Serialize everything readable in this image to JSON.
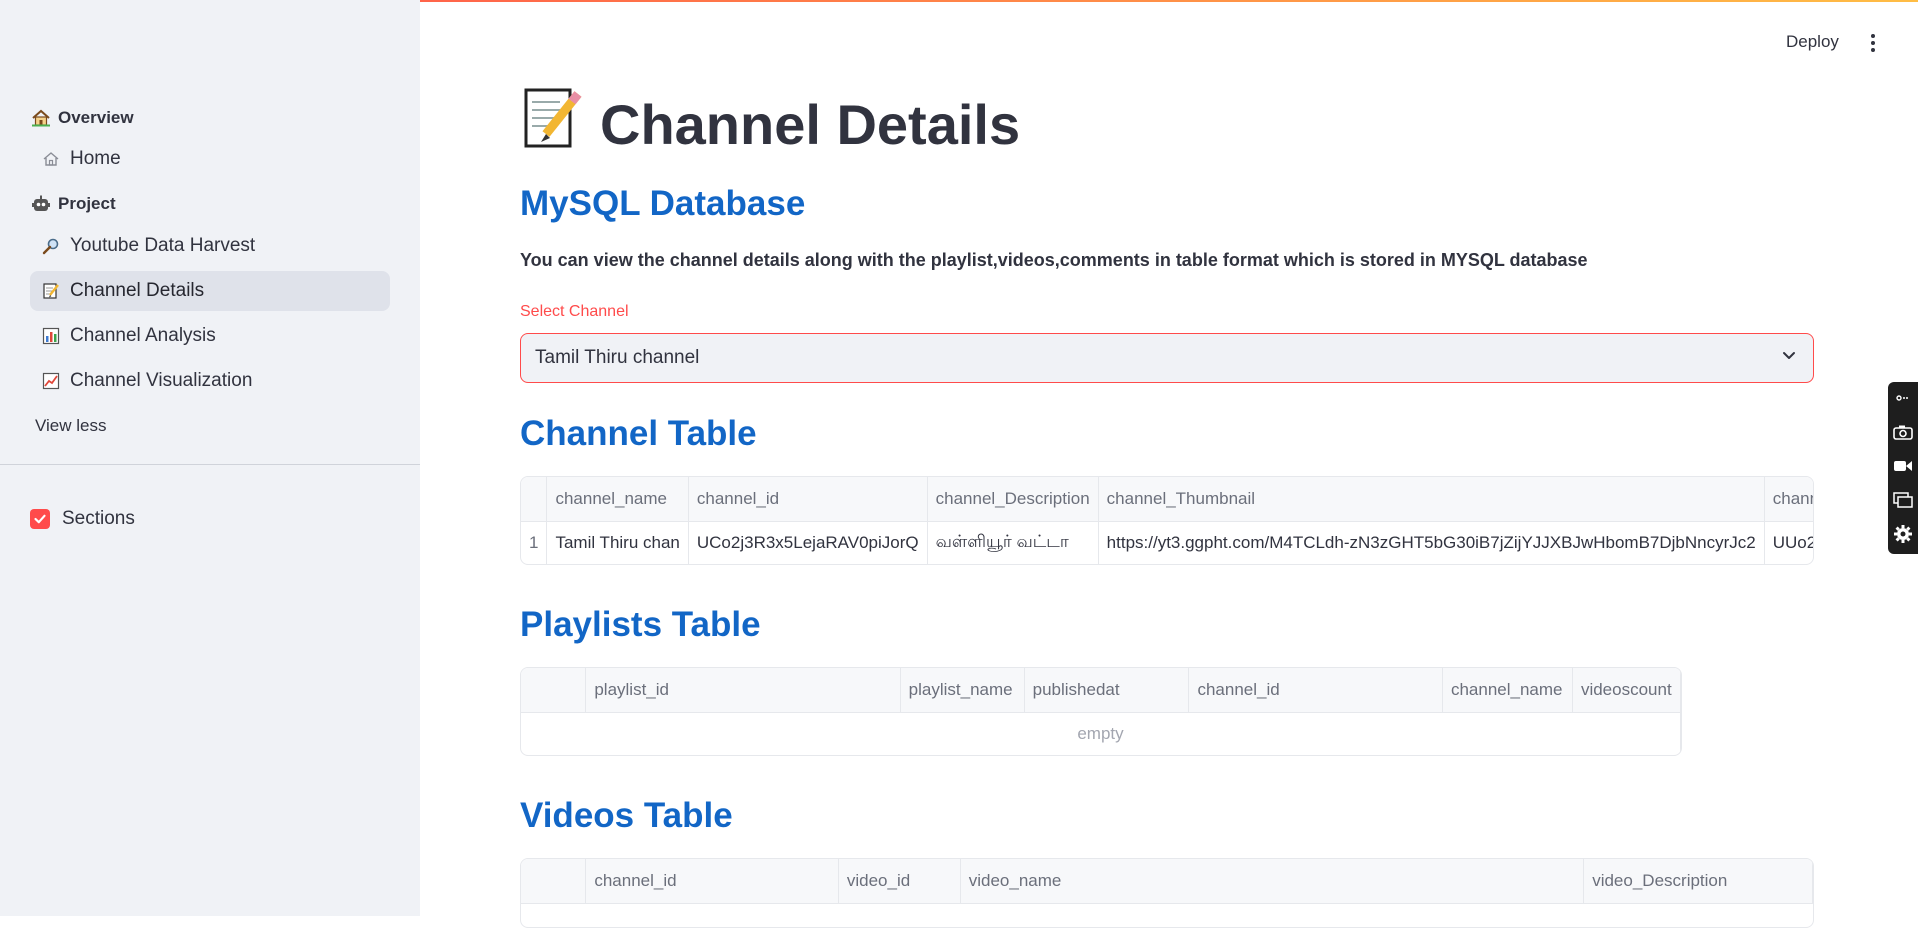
{
  "sidebar": {
    "groups": [
      {
        "label": "Overview",
        "icon": "house-icon"
      },
      {
        "label": "Project",
        "icon": "robot-icon"
      }
    ],
    "items": [
      {
        "label": "Home",
        "icon": "house-outline-icon"
      },
      {
        "label": "Youtube Data Harvest",
        "icon": "magnifier-icon"
      },
      {
        "label": "Channel Details",
        "icon": "memo-icon"
      },
      {
        "label": "Channel Analysis",
        "icon": "bar-chart-icon"
      },
      {
        "label": "Channel Visualization",
        "icon": "line-chart-icon"
      }
    ],
    "view_less": "View less",
    "checkbox_label": "Sections",
    "checkbox_checked": true
  },
  "header": {
    "deploy_label": "Deploy",
    "menu_icon": "kebab-menu-icon"
  },
  "main": {
    "title": "Channel Details",
    "title_icon": "memo-icon",
    "subtitle": "MySQL Database",
    "description": "You can view the channel details along with the playlist,videos,comments in table format which is stored in MYSQL database",
    "select": {
      "label": "Select Channel",
      "value": "Tamil Thiru channel"
    },
    "channel_table": {
      "heading": "Channel Table",
      "columns": [
        "",
        "channel_name",
        "channel_id",
        "channel_Description",
        "channel_Thumbnail",
        "chann"
      ],
      "rows": [
        [
          "1",
          "Tamil Thiru chan",
          "UCo2j3R3x5LejaRAV0piJorQ",
          "வள்ளியூர் வட்டா",
          "https://yt3.ggpht.com/M4TCLdh-zN3zGHT5bG30iB7jZijYJJXBJwHbomB7DjbNncyrJc2",
          "UUo2"
        ]
      ]
    },
    "playlists_table": {
      "heading": "Playlists Table",
      "columns": [
        "",
        "playlist_id",
        "playlist_name",
        "publishedat",
        "channel_id",
        "channel_name",
        "videoscount"
      ],
      "empty_text": "empty"
    },
    "videos_table": {
      "heading": "Videos Table",
      "columns": [
        "",
        "channel_id",
        "video_id",
        "video_name",
        "video_Description"
      ]
    }
  },
  "colors": {
    "accent": "#ff4b4b",
    "heading_blue": "#1266c6",
    "sidebar_bg": "#f0f2f6",
    "active_item_bg": "#dfe2ea"
  }
}
